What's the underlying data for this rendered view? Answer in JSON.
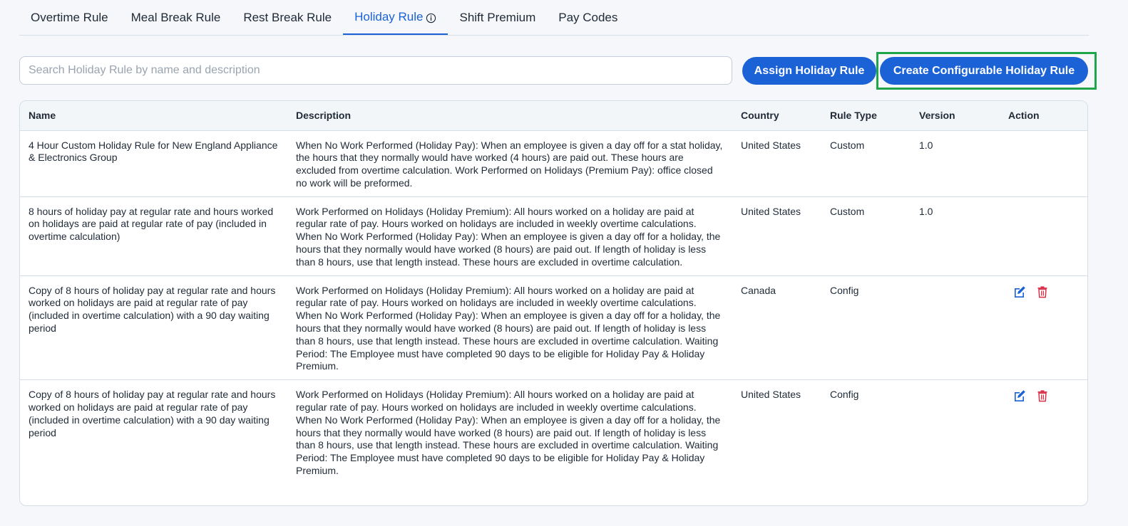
{
  "tabs": [
    {
      "label": "Overtime Rule",
      "active": false
    },
    {
      "label": "Meal Break Rule",
      "active": false
    },
    {
      "label": "Rest Break Rule",
      "active": false
    },
    {
      "label": "Holiday Rule",
      "active": true
    },
    {
      "label": "Shift Premium",
      "active": false
    },
    {
      "label": "Pay Codes",
      "active": false
    }
  ],
  "search": {
    "placeholder": "Search Holiday Rule by name and description",
    "value": ""
  },
  "buttons": {
    "assign": "Assign Holiday Rule",
    "create": "Create Configurable Holiday Rule"
  },
  "table": {
    "headers": {
      "name": "Name",
      "description": "Description",
      "country": "Country",
      "rule_type": "Rule Type",
      "version": "Version",
      "action": "Action"
    },
    "rows": [
      {
        "name": "4 Hour Custom Holiday Rule for New England Appliance & Electronics Group",
        "description": "When No Work Performed (Holiday Pay): When an employee is given a day off for a stat holiday, the hours that they normally would have worked (4 hours) are paid out. These hours are excluded from overtime calculation. Work Performed on Holidays (Premium Pay): office closed no work will be preformed.",
        "country": "United States",
        "rule_type": "Custom",
        "version": "1.0"
      },
      {
        "name": "8 hours of holiday pay at regular rate and hours worked on holidays are paid at regular rate of pay (included in overtime calculation)",
        "description": "Work Performed on Holidays (Holiday Premium): All hours worked on a holiday are paid at regular rate of pay. Hours worked on holidays are included in weekly overtime calculations. When No Work Performed (Holiday Pay): When an employee is given a day off for a holiday, the hours that they normally would have worked (8 hours) are paid out. If length of holiday is less than 8 hours, use that length instead. These hours are excluded in overtime calculation.",
        "country": "United States",
        "rule_type": "Custom",
        "version": "1.0"
      },
      {
        "name": "Copy of 8 hours of holiday pay at regular rate and hours worked on holidays are paid at regular rate of pay (included in overtime calculation) with a 90 day waiting period",
        "description": "Work Performed on Holidays (Holiday Premium): All hours worked on a holiday are paid at regular rate of pay. Hours worked on holidays are included in weekly overtime calculations. When No Work Performed (Holiday Pay): When an employee is given a day off for a holiday, the hours that they normally would have worked (8 hours) are paid out. If length of holiday is less than 8 hours, use that length instead. These hours are excluded in overtime calculation. Waiting Period: The Employee must have completed 90 days to be eligible for Holiday Pay & Holiday Premium.",
        "country": "Canada",
        "rule_type": "Config",
        "version": ""
      },
      {
        "name": "Copy of 8 hours of holiday pay at regular rate and hours worked on holidays are paid at regular rate of pay (included in overtime calculation) with a 90 day waiting period",
        "description": "Work Performed on Holidays (Holiday Premium): All hours worked on a holiday are paid at regular rate of pay. Hours worked on holidays are included in weekly overtime calculations. When No Work Performed (Holiday Pay): When an employee is given a day off for a holiday, the hours that they normally would have worked (8 hours) are paid out. If length of holiday is less than 8 hours, use that length instead. These hours are excluded in overtime calculation. Waiting Period: The Employee must have completed 90 days to be eligible for Holiday Pay & Holiday Premium.",
        "country": "United States",
        "rule_type": "Config",
        "version": ""
      }
    ]
  },
  "icons": {
    "info": "info-circle-icon",
    "edit": "edit-icon",
    "delete": "trash-icon"
  },
  "colors": {
    "accent": "#1a62d6",
    "delete": "#d9304a",
    "highlight": "#1fa54a"
  }
}
